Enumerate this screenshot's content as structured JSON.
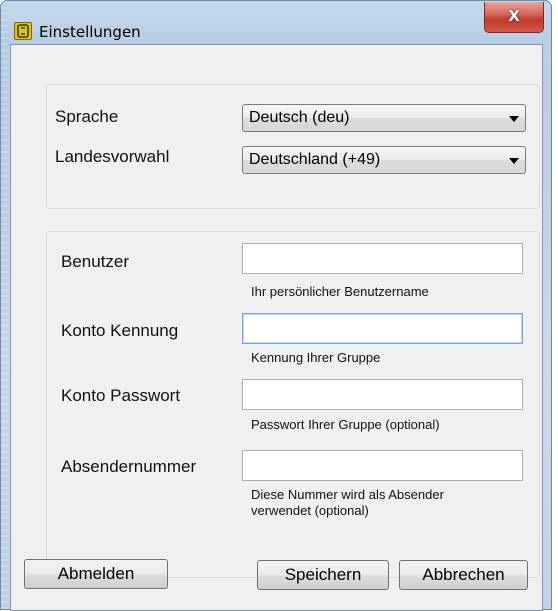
{
  "window": {
    "title": "Einstellungen",
    "close_glyph": "X"
  },
  "language_group": {
    "sprache_label": "Sprache",
    "sprache_value": "Deutsch (deu)",
    "landesvorwahl_label": "Landesvorwahl",
    "landesvorwahl_value": "Deutschland (+49)"
  },
  "account_group": {
    "benutzer_label": "Benutzer",
    "benutzer_value": "",
    "benutzer_hint": "Ihr persönlicher Benutzername",
    "kennung_label": "Konto Kennung",
    "kennung_value": "",
    "kennung_hint": "Kennung Ihrer Gruppe",
    "passwort_label": "Konto Passwort",
    "passwort_value": "",
    "passwort_hint": "Passwort Ihrer Gruppe (optional)",
    "absender_label": "Absendernummer",
    "absender_value": "",
    "absender_hint_line1": "Diese Nummer wird als Absender",
    "absender_hint_line2": "verwendet (optional)"
  },
  "buttons": {
    "abmelden": "Abmelden",
    "speichern": "Speichern",
    "abbrechen": "Abbrechen"
  },
  "icons": {
    "app": "app-logo-icon",
    "close": "close-icon",
    "dropdown": "chevron-down-icon"
  },
  "colors": {
    "close_button": "#c0392b",
    "dialog_bg": "#f0f0f0",
    "focus_border": "#7aa6d6"
  }
}
